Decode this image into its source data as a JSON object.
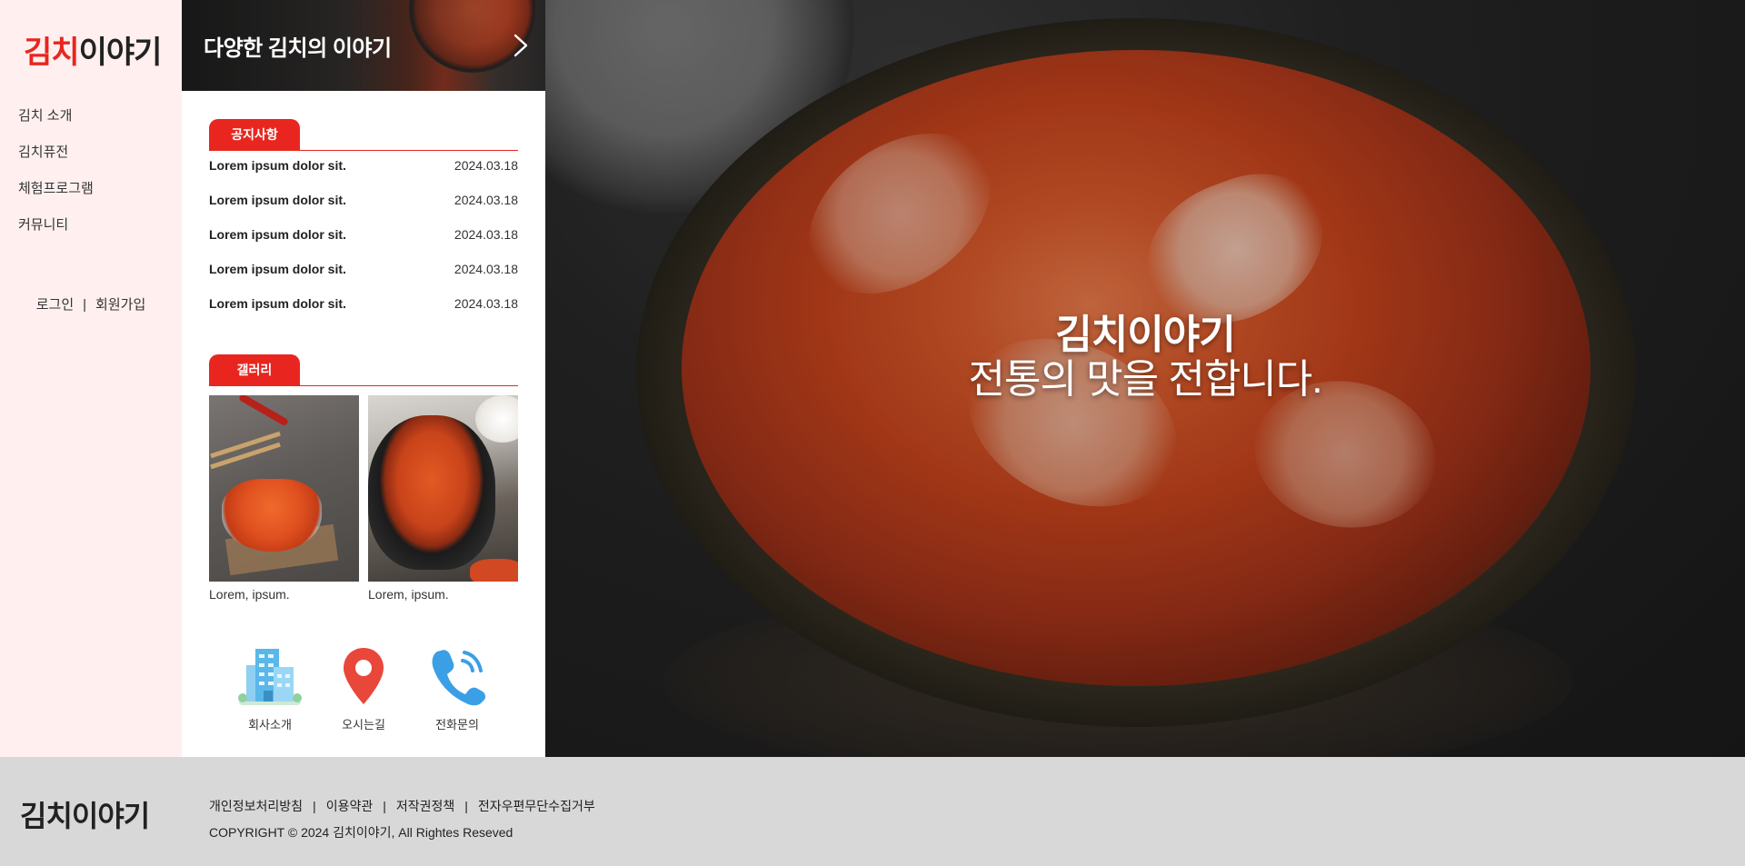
{
  "sidebar": {
    "logo": {
      "accent": "김치",
      "rest": "이야기"
    },
    "nav": [
      "김치 소개",
      "김치퓨전",
      "체험프로그램",
      "커뮤니티"
    ],
    "auth": {
      "login": "로그인",
      "separator": "|",
      "signup": "회원가입"
    }
  },
  "banner": {
    "title": "다양한 김치의 이야기",
    "arrow_icon": "chevron-right-icon"
  },
  "notice": {
    "tab_label": "공지사항",
    "items": [
      {
        "title": "Lorem ipsum dolor sit.",
        "date": "2024.03.18"
      },
      {
        "title": "Lorem ipsum dolor sit.",
        "date": "2024.03.18"
      },
      {
        "title": "Lorem ipsum dolor sit.",
        "date": "2024.03.18"
      },
      {
        "title": "Lorem ipsum dolor sit.",
        "date": "2024.03.18"
      },
      {
        "title": "Lorem ipsum dolor sit.",
        "date": "2024.03.18"
      }
    ]
  },
  "gallery": {
    "tab_label": "갤러리",
    "items": [
      {
        "caption": "Lorem, ipsum."
      },
      {
        "caption": "Lorem, ipsum."
      }
    ]
  },
  "quick_links": [
    {
      "label": "회사소개",
      "icon": "building-icon"
    },
    {
      "label": "오시는길",
      "icon": "map-pin-icon"
    },
    {
      "label": "전화문의",
      "icon": "phone-icon"
    }
  ],
  "hero": {
    "title": "김치이야기",
    "subtitle": "전통의 맛을 전합니다."
  },
  "footer": {
    "logo": "김치이야기",
    "links": [
      "개인정보처리방침",
      "이용약관",
      "저작권정책",
      "전자우편무단수집거부"
    ],
    "separator": "|",
    "copyright": "COPYRIGHT © 2024 김치이야기, All Rightes Reseved"
  },
  "colors": {
    "accent": "#e8261f",
    "sidebar_bg": "#fff0ef",
    "footer_bg": "#d8d8d8"
  }
}
